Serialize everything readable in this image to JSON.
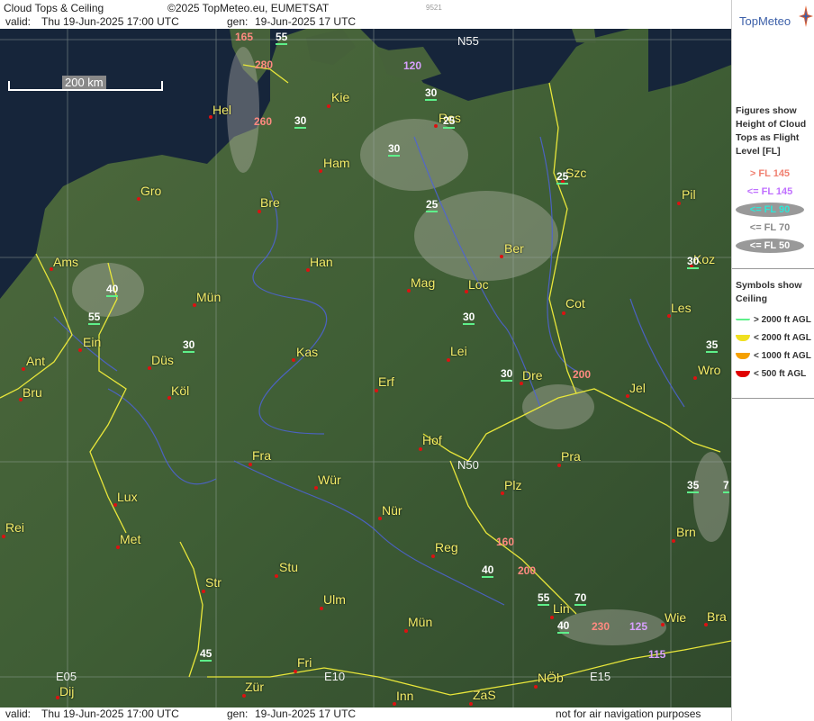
{
  "header": {
    "title": "Cloud Tops & Ceiling",
    "copyright": "©2025 TopMeteo.eu, EUMETSAT",
    "valid_label": "valid:",
    "valid_value": "Thu  19-Jun-2025  17:00 UTC",
    "gen_label": "gen:",
    "gen_value": "19-Jun-2025 17 UTC",
    "id": "9521"
  },
  "footer": {
    "valid_label": "valid:",
    "valid_value": "Thu  19-Jun-2025  17:00 UTC",
    "gen_label": "gen:",
    "gen_value": "19-Jun-2025 17 UTC",
    "disclaimer": "not for air navigation purposes"
  },
  "scale": {
    "label": "200 km"
  },
  "grid_labels": {
    "n55": "N55",
    "n50": "N50",
    "e05": "E05",
    "e10": "E10",
    "e15": "E15"
  },
  "cities": {
    "hel": "Hel",
    "kie": "Kie",
    "ros": "Ros",
    "ham": "Ham",
    "szc": "Szc",
    "gro": "Gro",
    "bre": "Bre",
    "pil": "Pil",
    "ber": "Ber",
    "ams": "Ams",
    "han": "Han",
    "koz": "Koz",
    "mag": "Mag",
    "loc": "Loc",
    "mun1": "Mün",
    "cot": "Cot",
    "les": "Les",
    "ein": "Ein",
    "lei": "Lei",
    "kas": "Kas",
    "ant": "Ant",
    "dus": "Düs",
    "dre": "Dre",
    "wro": "Wro",
    "bru": "Bru",
    "kol": "Köl",
    "erf": "Erf",
    "jel": "Jel",
    "hof": "Hof",
    "fra": "Fra",
    "pra": "Pra",
    "wur": "Wür",
    "lux": "Lux",
    "plz": "Plz",
    "nur": "Nür",
    "rei": "Rei",
    "met": "Met",
    "brn": "Brn",
    "reg": "Reg",
    "stu": "Stu",
    "str": "Str",
    "ulm": "Ulm",
    "lin": "Lin",
    "mun2": "Mün",
    "wie": "Wie",
    "bra": "Bra",
    "fri": "Fri",
    "dij": "Dij",
    "zur": "Zür",
    "nob": "NÖb",
    "inn": "Inn",
    "zas": "ZaS"
  },
  "cloud_tops": {
    "t1": "165",
    "t2": "55",
    "t3": "280",
    "t4": "120",
    "t5": "30",
    "t6": "260",
    "t7": "30",
    "t8": "25",
    "t9": "30",
    "t10": "25",
    "t11": "25",
    "t12": "30",
    "t13": "40",
    "t14": "55",
    "t15": "30",
    "t16": "30",
    "t17": "35",
    "t18": "30",
    "t19": "200",
    "t20": "35",
    "t21": "7",
    "t22": "160",
    "t23": "40",
    "t24": "200",
    "t25": "55",
    "t26": "70",
    "t27": "40",
    "t28": "230",
    "t29": "125",
    "t30": "45",
    "t31": "115"
  },
  "legend": {
    "brand": "TopMeteo",
    "tops_title": "Figures show Height of Cloud Tops as Flight Level  [FL]",
    "fl_gt145": "> FL 145",
    "fl_le145": "<= FL 145",
    "fl_le90": "<= FL 90",
    "fl_le70": "<= FL 70",
    "fl_le50": "<= FL 50",
    "ceiling_title": "Symbols show Ceiling",
    "c1": "> 2000 ft AGL",
    "c2": "< 2000 ft AGL",
    "c3": "< 1000 ft AGL",
    "c4": "< 500 ft AGL",
    "colors": {
      "gt145": "#f08070",
      "le145": "#c070ff",
      "le90": "#2ee6d6",
      "le70": "#888888",
      "le50": "#ffffff",
      "c1": "#5ef08a",
      "c2": "#f0e020",
      "c3": "#f5a000",
      "c4": "#e00000"
    }
  }
}
